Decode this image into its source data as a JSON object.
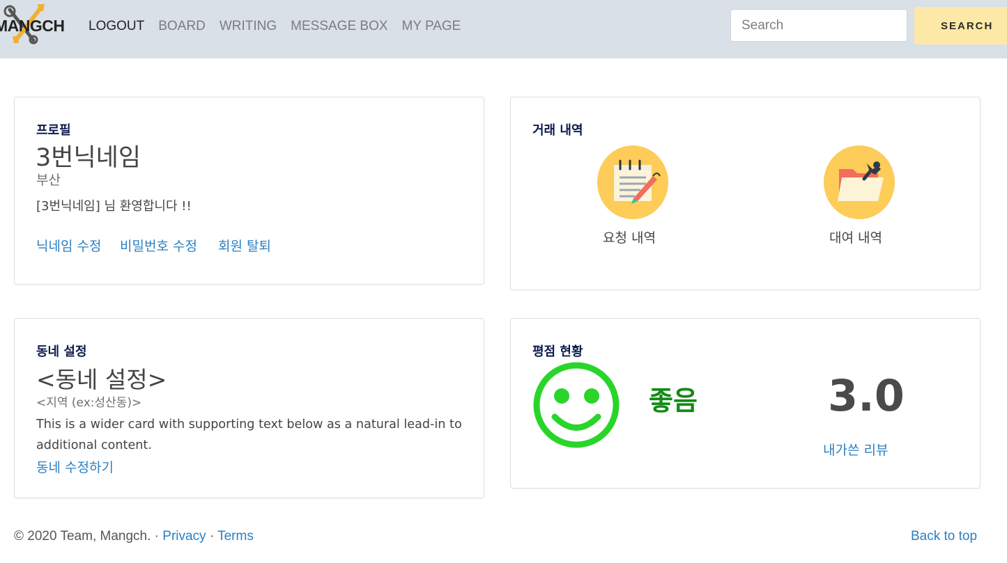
{
  "brand": {
    "logo_text": "MANGCH"
  },
  "nav": {
    "items": [
      {
        "label": "LOGOUT",
        "active": true
      },
      {
        "label": "BOARD",
        "active": false
      },
      {
        "label": "WRITING",
        "active": false
      },
      {
        "label": "MESSAGE BOX",
        "active": false
      },
      {
        "label": "MY PAGE",
        "active": false
      }
    ],
    "search_placeholder": "Search",
    "search_button": "SEARCH"
  },
  "profile": {
    "label": "프로필",
    "nickname": "3번닉네임",
    "region": "부산",
    "welcome": "[3번닉네임] 님 환영합니다 !!",
    "links": [
      "닉네임 수정",
      "비밀번호 수정",
      "회원 탈퇴"
    ]
  },
  "history": {
    "label": "거래 내역",
    "items": [
      {
        "caption": "요청 내역",
        "icon": "notepad-pen-icon"
      },
      {
        "caption": "대여 내역",
        "icon": "folder-wrench-icon"
      }
    ]
  },
  "neighborhood": {
    "label": "동네 설정",
    "title": "<동네 설정>",
    "region_hint": "<지역 (ex:성산동)>",
    "description_line1": "This is a wider card with supporting text below as a natural lead-in to",
    "description_line2": "additional content.",
    "edit_link": "동네 수정하기"
  },
  "rating": {
    "label": "평점 현황",
    "icon": "smiley-icon",
    "word": "좋음",
    "score": "3.0",
    "reviews_link": "내가쓴 리뷰",
    "colors": {
      "smiley": "#2ad52a",
      "word": "#138a13"
    }
  },
  "footer": {
    "copyright": "© 2020 Team, Mangch. · ",
    "privacy": "Privacy",
    "separator": " · ",
    "terms": "Terms",
    "back_to_top": "Back to top"
  },
  "colors": {
    "navbar_bg": "#d9e0e7",
    "search_button_bg": "#fde9a7",
    "link": "#2a7fc2",
    "label": "#0d1b4c",
    "icon_circle": "#fdcc59"
  }
}
